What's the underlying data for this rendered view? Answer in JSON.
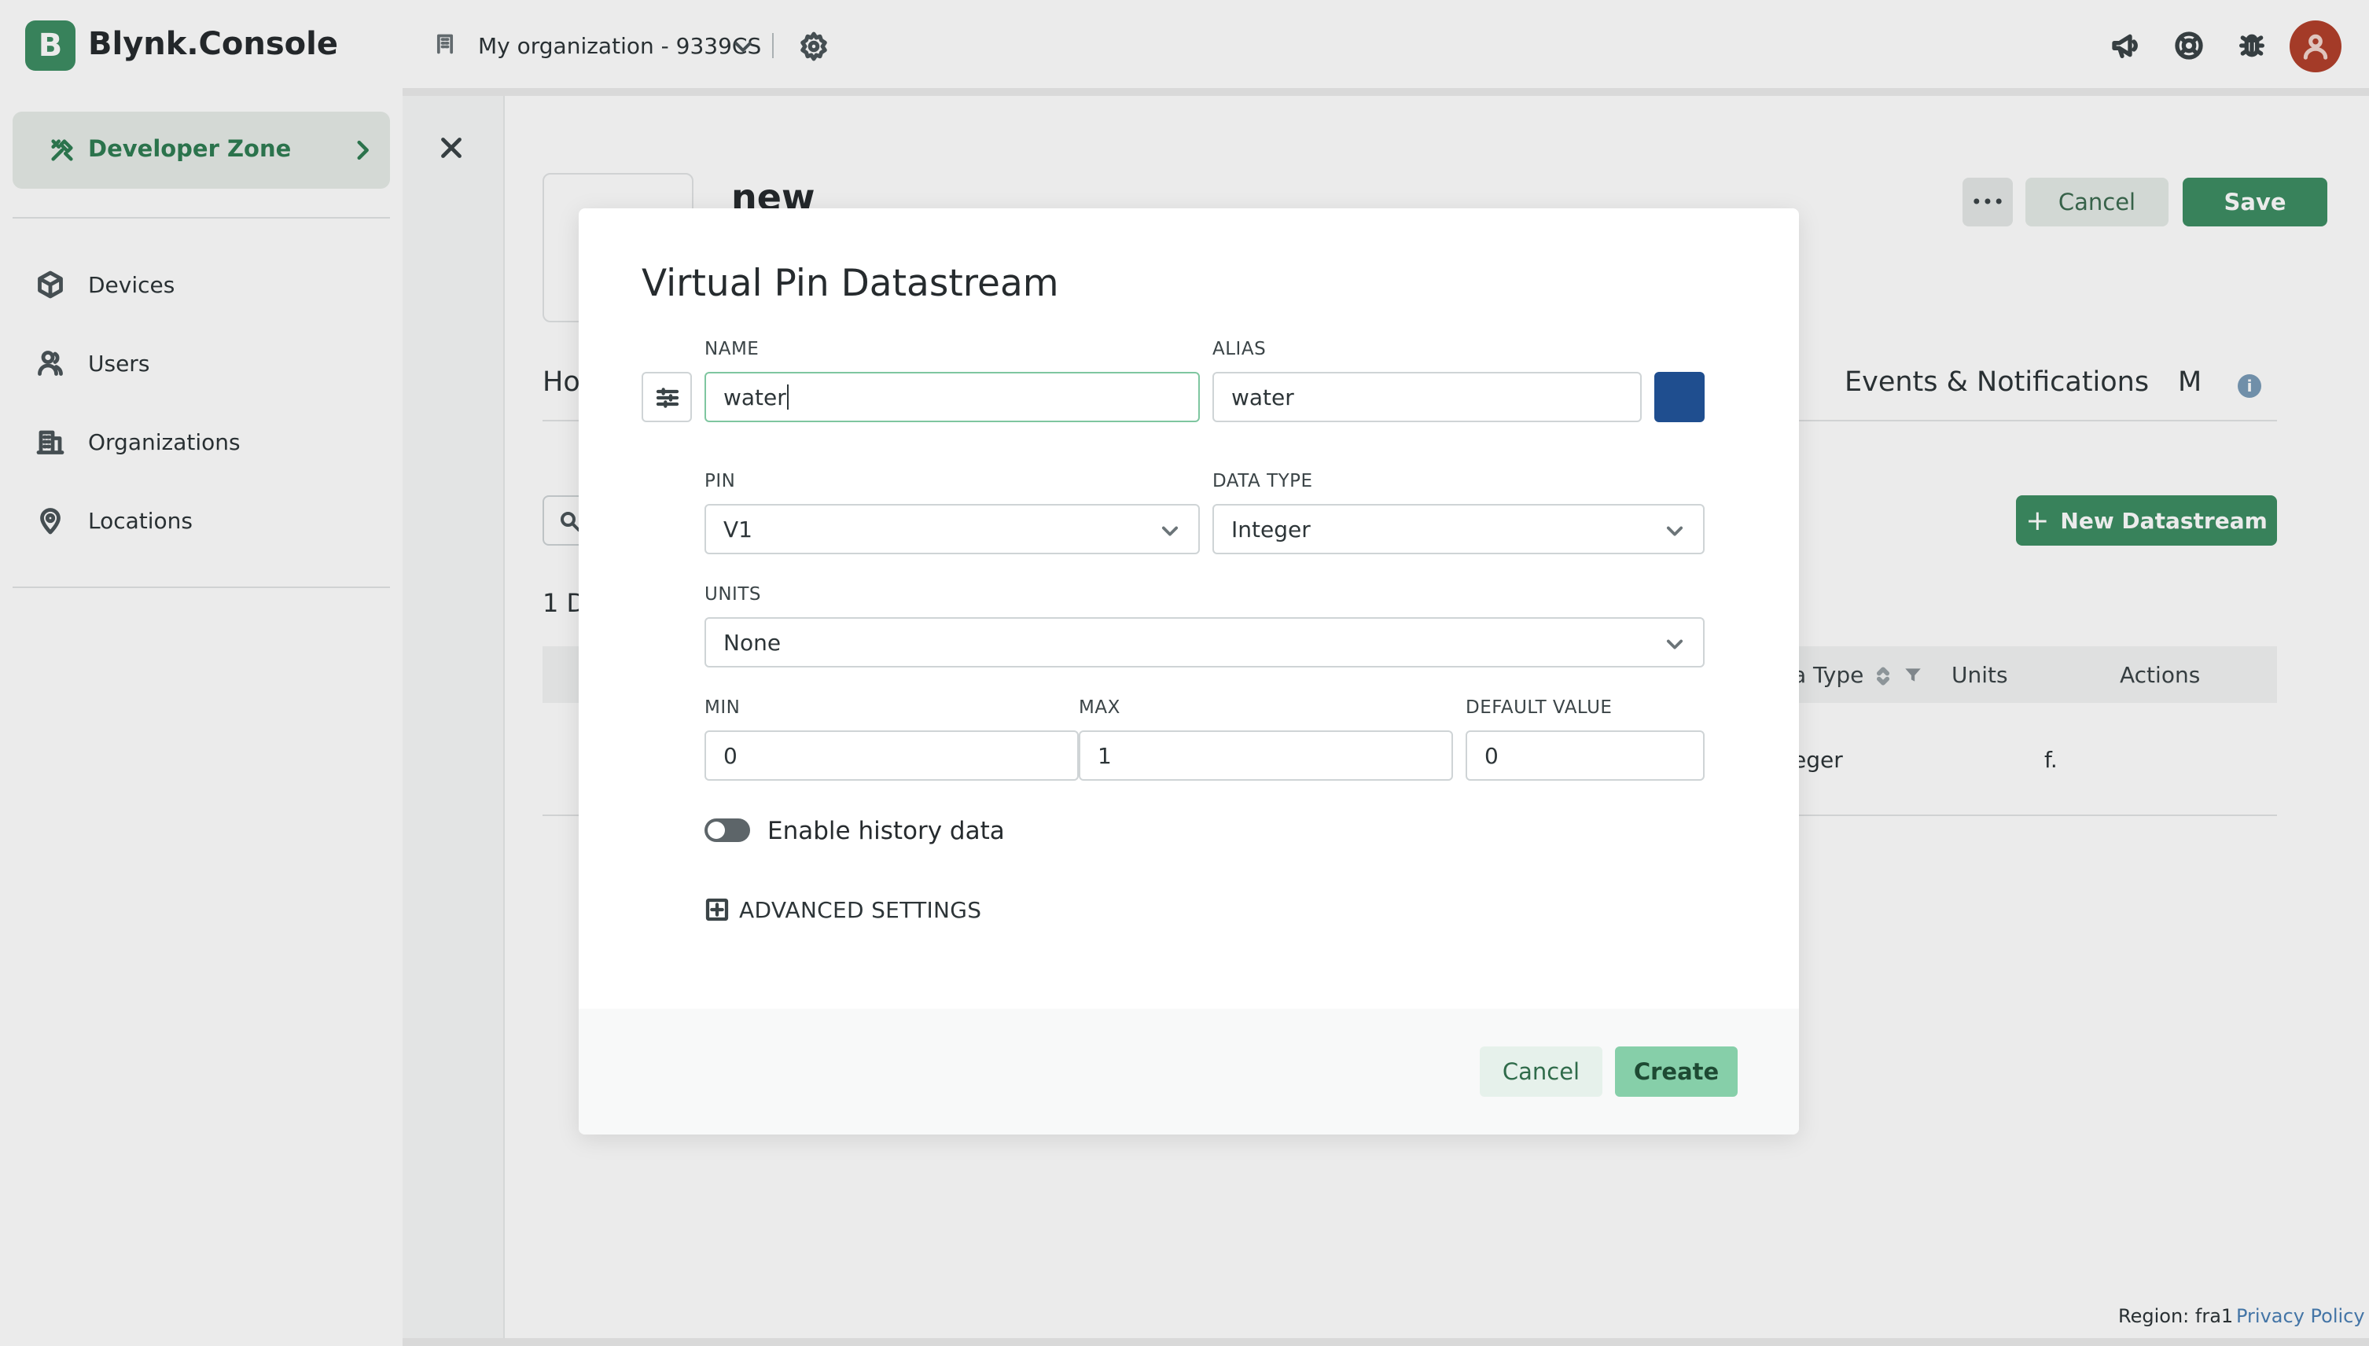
{
  "app": {
    "logo_letter": "B",
    "name": "Blynk.Console"
  },
  "sidebar": {
    "developer_zone": "Developer Zone",
    "items": [
      {
        "label": "Devices",
        "icon": "cube-icon"
      },
      {
        "label": "Users",
        "icon": "users-icon"
      },
      {
        "label": "Organizations",
        "icon": "building-icon"
      },
      {
        "label": "Locations",
        "icon": "location-pin-icon"
      }
    ]
  },
  "topbar": {
    "org_name": "My organization - 9339CS",
    "icons": [
      "megaphone-icon",
      "support-icon",
      "bug-icon",
      "avatar"
    ]
  },
  "page": {
    "template_title": "new",
    "more_label": "•••",
    "cancel_label": "Cancel",
    "save_label": "Save",
    "tab_home": "Ho",
    "tab_events": "Events & Notifications",
    "tab_more": "M",
    "new_datastream_label": "New Datastream",
    "new_datastream_plus": "+",
    "datastream_count": "1 D",
    "table_headers": {
      "data_type": "a Type",
      "units": "Units",
      "actions": "Actions"
    },
    "row": {
      "data_type": "eger",
      "units": "f."
    },
    "region": "Region: fra1",
    "privacy": "Privacy Policy"
  },
  "modal": {
    "title": "Virtual Pin Datastream",
    "name_label": "NAME",
    "name_value": "water",
    "alias_label": "ALIAS",
    "alias_value": "water",
    "color": "#1f4e8f",
    "pin_label": "PIN",
    "pin_value": "V1",
    "data_type_label": "DATA TYPE",
    "data_type_value": "Integer",
    "units_label": "UNITS",
    "units_value": "None",
    "min_label": "MIN",
    "min_value": "0",
    "max_label": "MAX",
    "max_value": "1",
    "default_label": "DEFAULT VALUE",
    "default_value": "0",
    "history_label": "Enable history data",
    "history_enabled": false,
    "advanced_label": "ADVANCED SETTINGS",
    "cancel_label": "Cancel",
    "create_label": "Create"
  },
  "colors": {
    "brand": "#3d8e63",
    "create_button": "#86cfa9",
    "swatch": "#1f4e8f"
  }
}
